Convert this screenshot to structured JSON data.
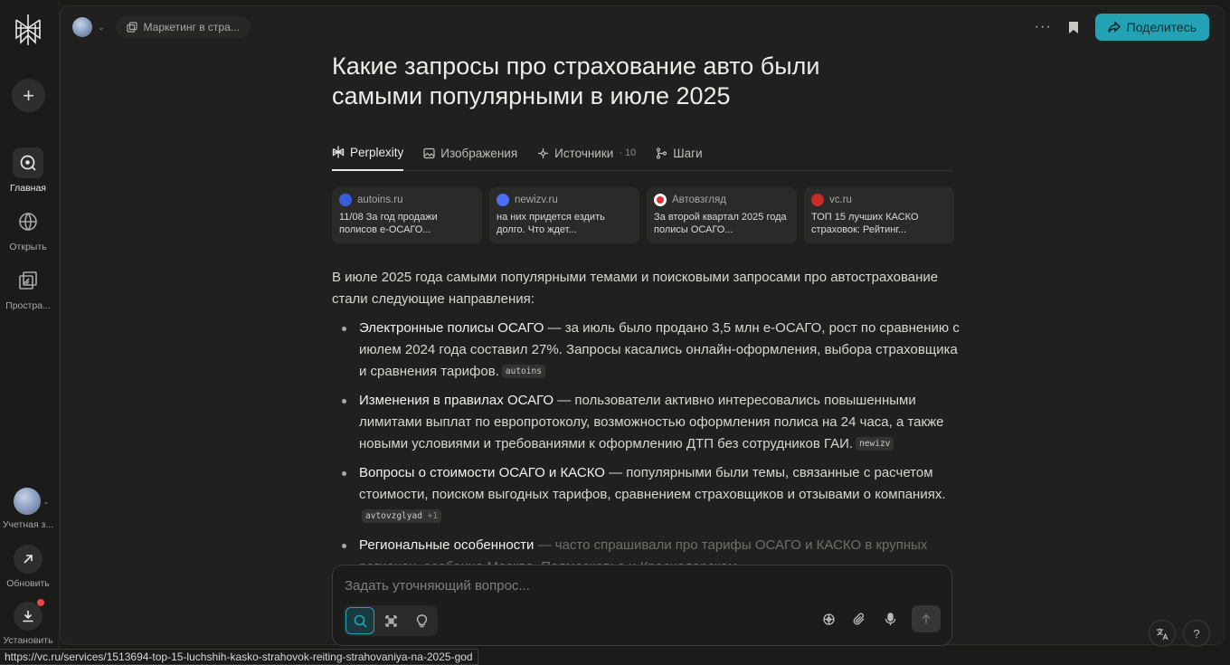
{
  "sidebar": {
    "new_label": "+",
    "nav": [
      {
        "label": "Главная",
        "icon": "home-icon"
      },
      {
        "label": "Открыть",
        "icon": "discover-icon"
      },
      {
        "label": "Простра...",
        "icon": "spaces-icon"
      }
    ],
    "bottom": [
      {
        "label": "Учетная з...",
        "icon": "account-avatar"
      },
      {
        "label": "Обновить",
        "icon": "upgrade-arrow-icon"
      },
      {
        "label": "Установить",
        "icon": "download-icon"
      }
    ]
  },
  "topbar": {
    "space_label": "Маркетинг в стра...",
    "more_label": "···",
    "share_label": "Поделитесь"
  },
  "thread": {
    "title": "Какие запросы про страхование авто были самыми популярными в июле 2025",
    "tabs": [
      {
        "label": "Perplexity",
        "count": ""
      },
      {
        "label": "Изображения",
        "count": ""
      },
      {
        "label": "Источники",
        "count": "· 10"
      },
      {
        "label": "Шаги",
        "count": ""
      }
    ],
    "sources": [
      {
        "site": "autoins.ru",
        "text": "11/08 За год продажи полисов е-ОСАГО...",
        "color": "#3b5bdb"
      },
      {
        "site": "newizv.ru",
        "text": "на них придется ездить долго. Что ждет...",
        "color": "#4c6ef5"
      },
      {
        "site": "Автовзгляд",
        "text": "За второй квартал 2025 года полисы ОСАГО...",
        "color": "#e03131"
      },
      {
        "site": "vc.ru",
        "text": "ТОП 15 лучших КАСКО страховок: Рейтинг...",
        "color": "#c92a2a"
      }
    ],
    "intro": "В июле 2025 года самыми популярными темами и поисковыми запросами про автострахование стали следующие направления:",
    "bullets": [
      {
        "head": "Электронные полисы ОСАГО",
        "text": " — за июль было продано 3,5 млн е-ОСАГО, рост по сравнению с июлем 2024 года составил 27%. Запросы касались онлайн-оформления, выбора страховщика и сравнения тарифов.",
        "cite": "autoins",
        "extra": ""
      },
      {
        "head": "Изменения в правилах ОСАГО",
        "text": " — пользователи активно интересовались повышенными лимитами выплат по европротоколу, возможностью оформления полиса на 24 часа, а также новыми условиями и требованиями к оформлению ДТП без сотрудников ГАИ.",
        "cite": "newizv",
        "extra": ""
      },
      {
        "head": "Вопросы о стоимости ОСАГО и КАСКО",
        "text": " — популярными были темы, связанные с расчетом стоимости, поиском выгодных тарифов, сравнением страховщиков и отзывами о компаниях.",
        "cite": "avtovzglyad",
        "extra": "+1"
      },
      {
        "head": "Региональные особенности",
        "text": " — часто спрашивали про тарифы ОСАГО и КАСКО в крупных регионах, особенно Москве, Подмосковье и Краснодарском...",
        "cite": "",
        "extra": ""
      }
    ]
  },
  "ask": {
    "placeholder": "Задать уточняющий вопрос..."
  },
  "status_url": "https://vc.ru/services/1513694-top-15-luchshih-kasko-strahovok-reiting-strahovaniya-na-2025-god",
  "colors": {
    "accent": "#22a2b3",
    "background": "#202020",
    "sidebar": "#1b1b1a"
  }
}
